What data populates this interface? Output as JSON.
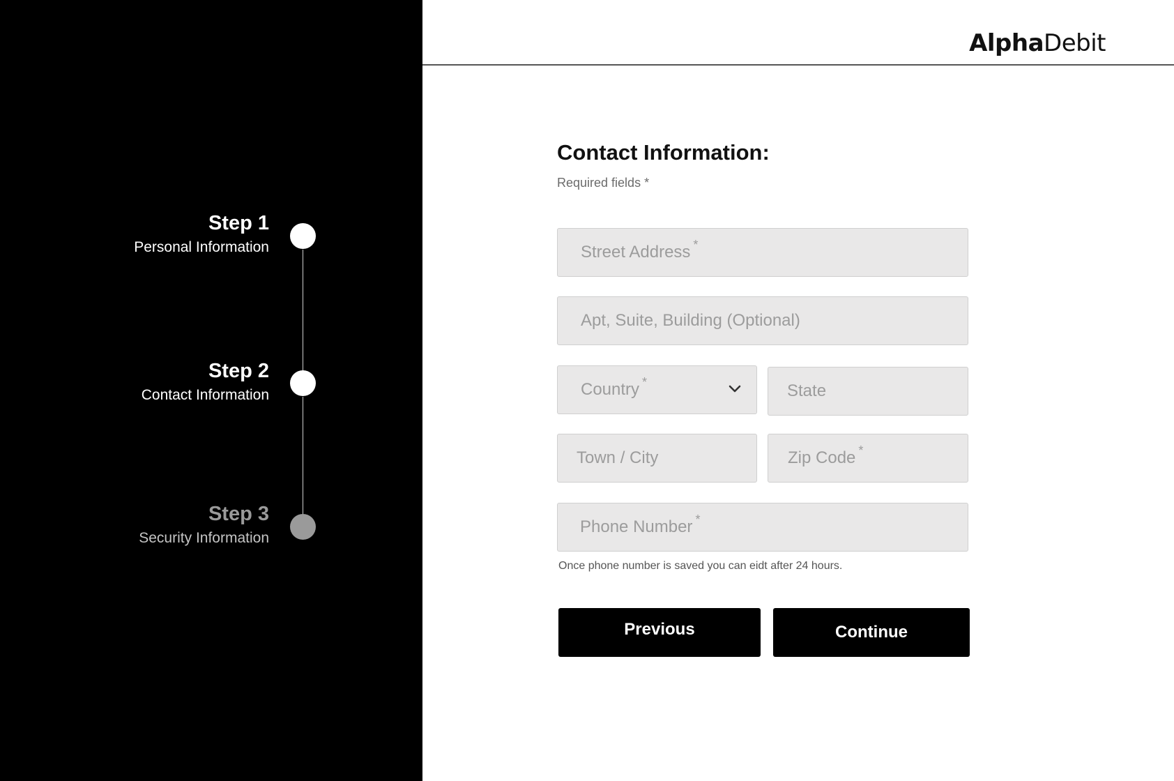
{
  "brand": {
    "bold": "Alpha",
    "regular": "Debit"
  },
  "steps": [
    {
      "title": "Step 1",
      "subtitle": "Personal Information",
      "state": "completed"
    },
    {
      "title": "Step 2",
      "subtitle": "Contact Information",
      "state": "current"
    },
    {
      "title": "Step 3",
      "subtitle": "Security Information",
      "state": "upcoming"
    }
  ],
  "form": {
    "title": "Contact Information:",
    "required_note": "Required fields *",
    "fields": {
      "street": {
        "placeholder": "Street Address",
        "required_mark": "*"
      },
      "apt": {
        "placeholder": "Apt, Suite, Building (Optional)"
      },
      "country": {
        "placeholder": "Country",
        "required_mark": "*",
        "icon": "chevron-down-icon"
      },
      "state": {
        "placeholder": "State"
      },
      "city": {
        "placeholder": "Town / City"
      },
      "zip": {
        "placeholder": "Zip Code",
        "required_mark": "*"
      },
      "phone": {
        "placeholder": "Phone Number",
        "required_mark": "*"
      }
    },
    "phone_hint": "Once phone number is saved you can eidt after 24 hours.",
    "previous_label": "Previous",
    "continue_label": "Continue"
  },
  "colors": {
    "sidebar_bg": "#000000",
    "step_active": "#ffffff",
    "step_inactive": "#9a9a9a",
    "field_bg": "#e9e8e8",
    "button_bg": "#000000"
  }
}
